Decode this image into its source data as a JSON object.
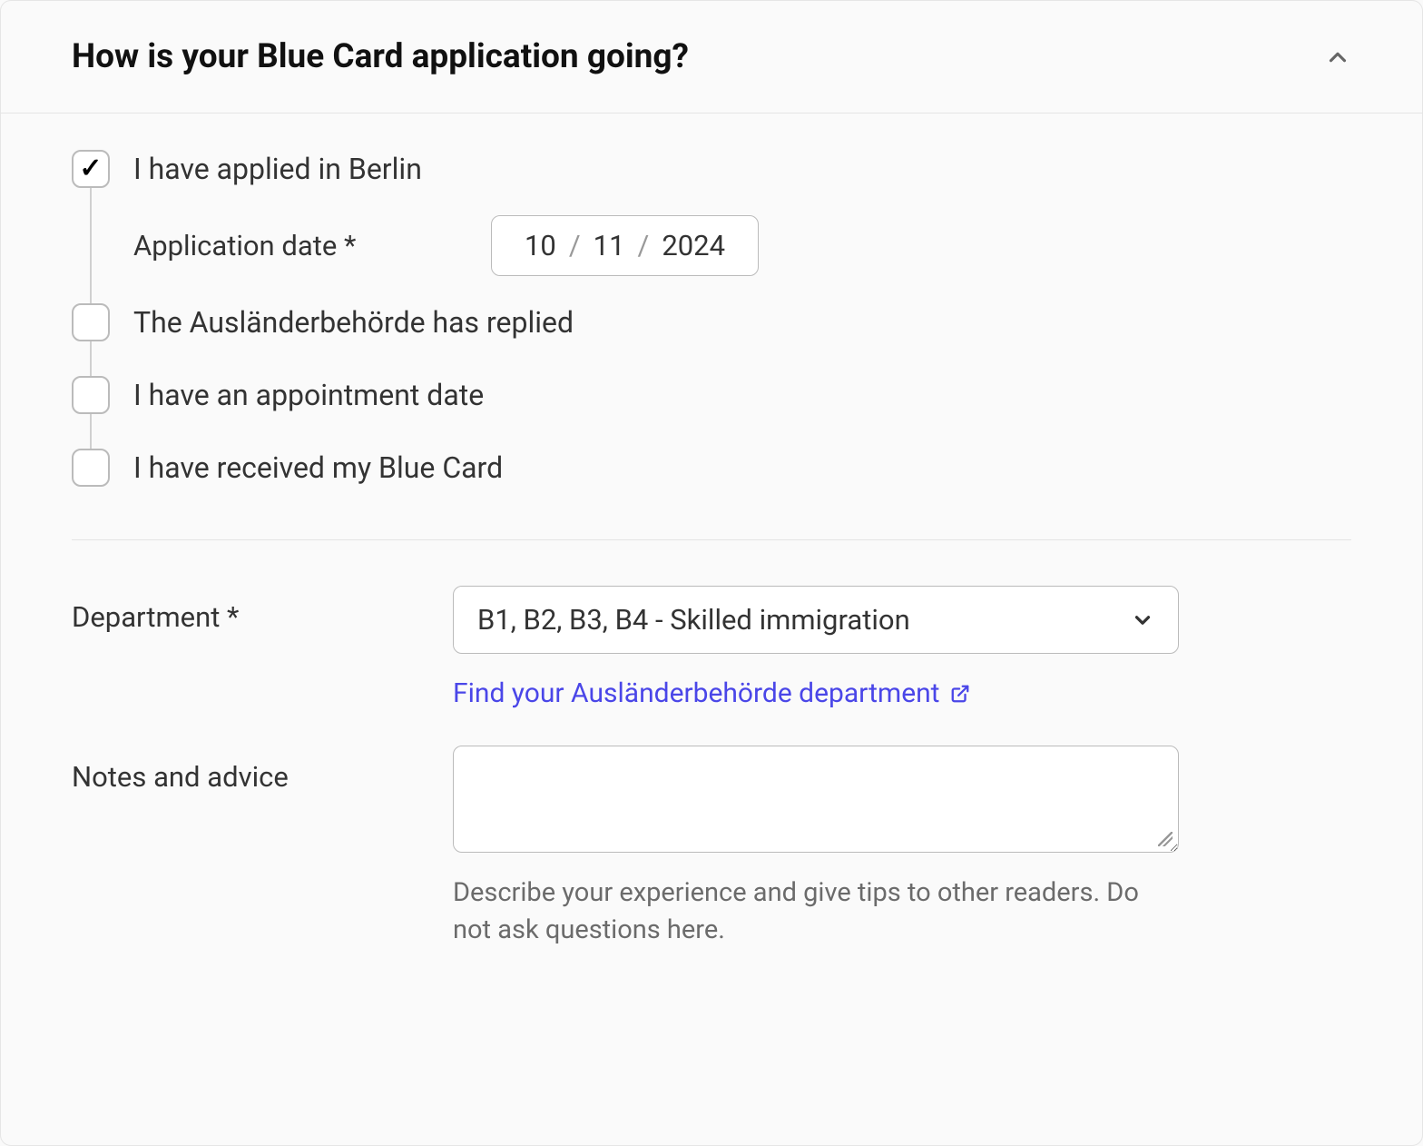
{
  "header": {
    "title": "How is your Blue Card application going?"
  },
  "checklist": {
    "items": [
      {
        "label": "I have applied in Berlin",
        "checked": true
      },
      {
        "label": "The Ausländerbehörde has replied",
        "checked": false
      },
      {
        "label": "I have an appointment date",
        "checked": false
      },
      {
        "label": "I have received my Blue Card",
        "checked": false
      }
    ],
    "application_date": {
      "label": "Application date *",
      "day": "10",
      "month": "11",
      "year": "2024"
    }
  },
  "department": {
    "label": "Department *",
    "selected": "B1, B2, B3, B4 - Skilled immigration",
    "help_link": "Find your Ausländerbehörde department"
  },
  "notes": {
    "label": "Notes and advice",
    "help": "Describe your experience and give tips to other readers. Do not ask questions here."
  }
}
